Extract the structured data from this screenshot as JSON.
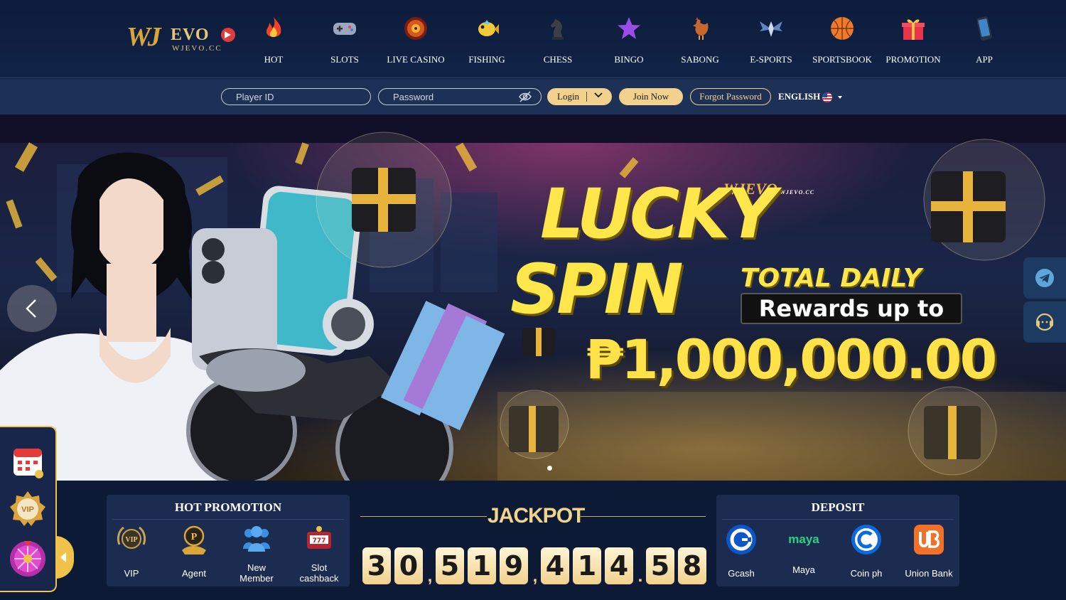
{
  "brand": {
    "logo_main": "WJ",
    "logo_evo": "EVO",
    "logo_sub": "WJEVO.CC"
  },
  "nav": {
    "items": [
      {
        "label": "HOT",
        "icon": "fire-icon"
      },
      {
        "label": "SLOTS",
        "icon": "gamepad-icon"
      },
      {
        "label": "LIVE CASINO",
        "icon": "roulette-icon"
      },
      {
        "label": "FISHING",
        "icon": "fish-icon"
      },
      {
        "label": "CHESS",
        "icon": "chess-knight-icon"
      },
      {
        "label": "BINGO",
        "icon": "star-icon"
      },
      {
        "label": "SABONG",
        "icon": "rooster-icon"
      },
      {
        "label": "E-SPORTS",
        "icon": "esports-wings-icon"
      },
      {
        "label": "SPORTSBOOK",
        "icon": "basketball-icon"
      },
      {
        "label": "PROMOTION",
        "icon": "gift-icon"
      },
      {
        "label": "APP",
        "icon": "phone-icon"
      }
    ]
  },
  "login": {
    "player_id_placeholder": "Player ID",
    "password_placeholder": "Password",
    "login_label": "Login",
    "join_label": "Join Now",
    "forgot_label": "Forgot Password",
    "language": "ENGLISH"
  },
  "banner": {
    "logo": "WJEVO",
    "logo_sub": "WJEVO.CC",
    "headline_1": "LUCKY",
    "headline_2": "SPIN",
    "total_daily": "TOTAL DAILY",
    "rewards": "Rewards up to",
    "amount": "₱1,000,000.00"
  },
  "hot_promotion": {
    "title": "HOT PROMOTION",
    "items": [
      {
        "label": "VIP",
        "icon": "vip-badge-icon"
      },
      {
        "label": "Agent",
        "icon": "agent-icon"
      },
      {
        "label": "New Member",
        "icon": "users-icon"
      },
      {
        "label": "Slot cashback",
        "icon": "slot-machine-icon"
      }
    ]
  },
  "jackpot": {
    "title": "JACKPOT",
    "value": "30,519,414.58"
  },
  "deposit": {
    "title": "DEPOSIT",
    "items": [
      {
        "label": "Gcash",
        "icon": "gcash-icon"
      },
      {
        "label": "Maya",
        "icon": "maya-icon",
        "logo_text": "maya"
      },
      {
        "label": "Coin ph",
        "icon": "coinph-icon"
      },
      {
        "label": "Union Bank",
        "icon": "unionbank-icon"
      }
    ]
  },
  "floating": {
    "items": [
      "calendar-icon",
      "vip-medal-icon",
      "lucky-wheel-icon"
    ]
  },
  "colors": {
    "accent_gold": "#f2d18e",
    "nav_bg": "#0d1c3b",
    "login_bar": "#1d3156",
    "card_bg": "#1c2c50"
  }
}
